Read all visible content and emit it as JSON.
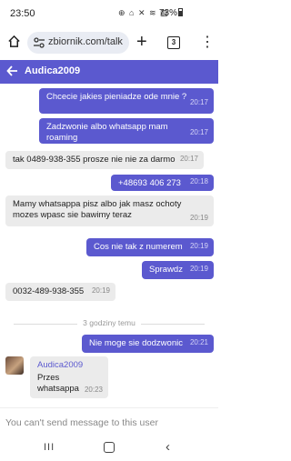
{
  "status": {
    "time": "23:50",
    "icons": "⊕ ⌂ ✕ ≋ ▥",
    "battery": "73%"
  },
  "browser": {
    "url": "zbiornik.com/talk",
    "tab_count": "3"
  },
  "chat": {
    "contact": "Audica2009",
    "messages": [
      {
        "dir": "out",
        "text": "Chcecie jakies pieniadze ode mnie ?",
        "time": "20:17"
      },
      {
        "dir": "out",
        "text": "Zadzwonie albo whatsapp mam roaming",
        "time": "20:17"
      },
      {
        "dir": "in",
        "text": "tak 0489-938-355 prosze nie nie za darmo",
        "time": "20:17"
      },
      {
        "dir": "out",
        "text": "+48693 406 273",
        "time": "20:18"
      },
      {
        "dir": "in",
        "text": "Mamy whatsappa pisz albo jak masz ochoty mozes wpasc sie bawimy teraz",
        "time": "20:19"
      },
      {
        "dir": "out",
        "text": "Cos nie tak z numerem",
        "time": "20:19"
      },
      {
        "dir": "out",
        "text": "Sprawdz",
        "time": "20:19"
      },
      {
        "dir": "in",
        "text": "0032-489-938-355",
        "time": "20:19"
      },
      {
        "dir": "out",
        "text": "Nie moge sie dodzwonic",
        "time": "20:21"
      },
      {
        "dir": "in",
        "sender": "Audica2009",
        "text": "Przes whatsappa",
        "time": "20:23"
      }
    ],
    "divider": "3 godziny temu",
    "footer_note": "You can't send message to this user"
  },
  "nav": {
    "recents": "III"
  }
}
